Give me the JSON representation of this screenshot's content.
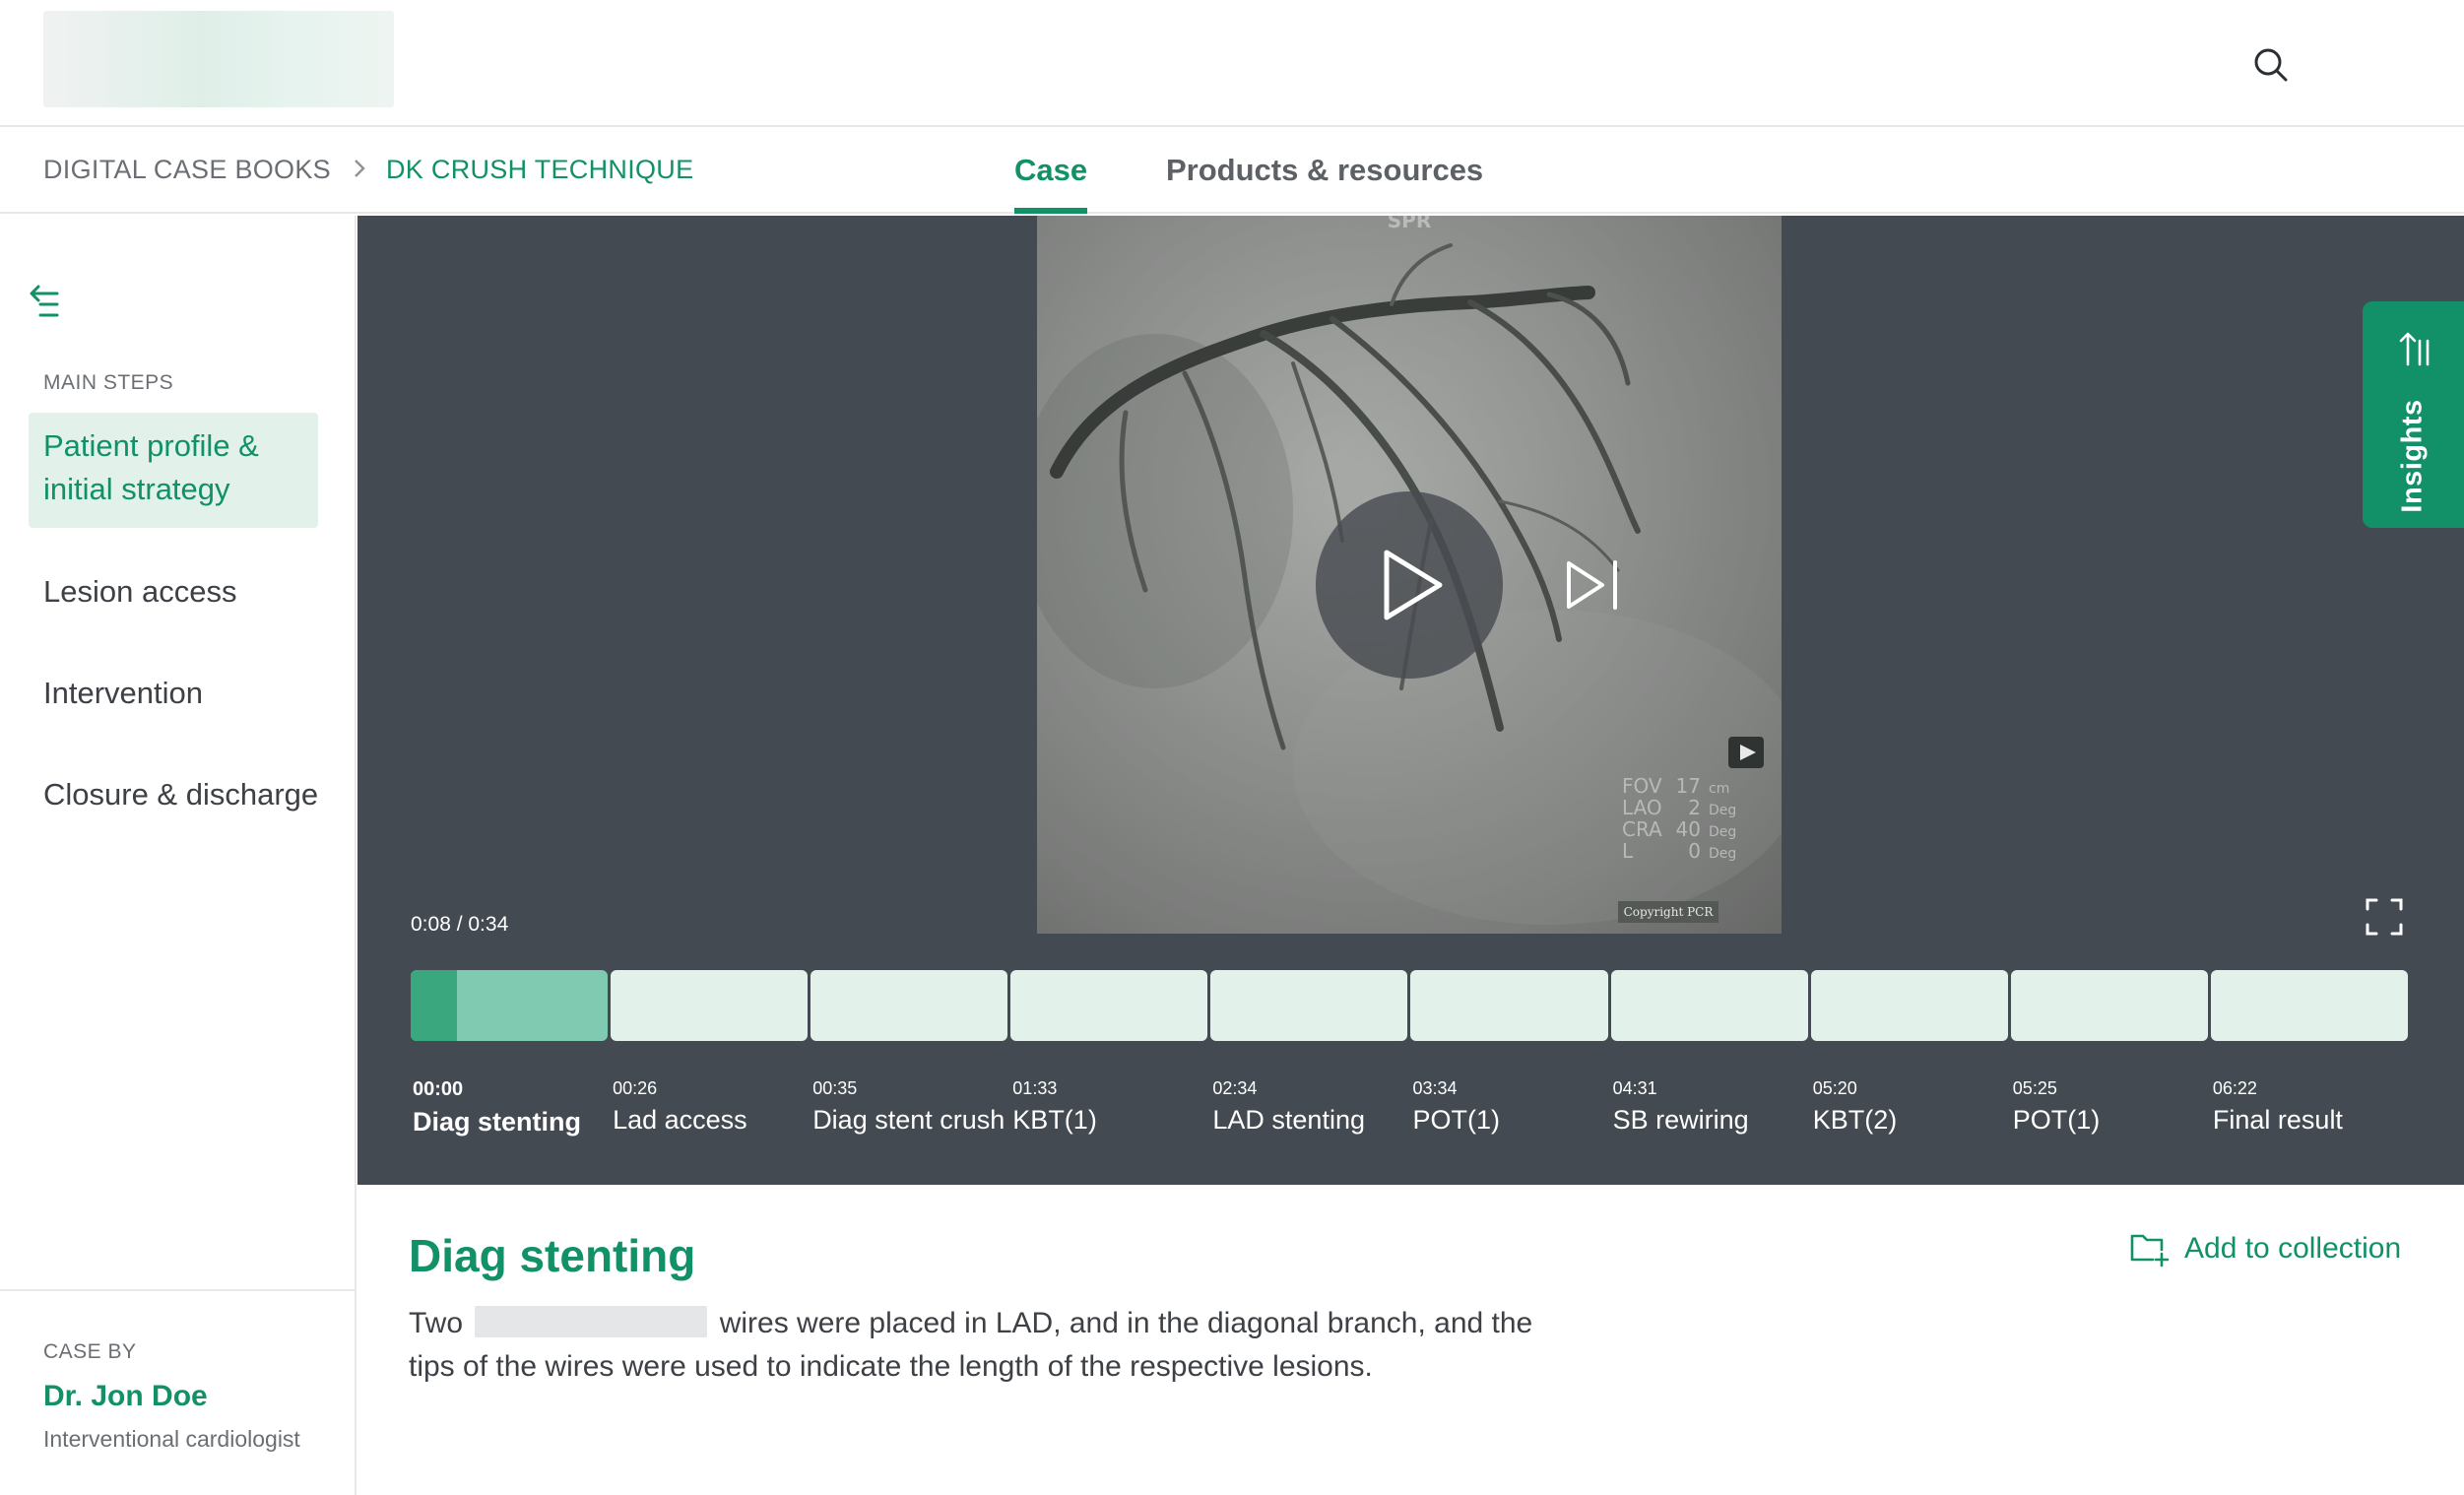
{
  "header": {
    "logo_alt": "",
    "search_icon": "search-icon"
  },
  "breadcrumb": {
    "root": "DIGITAL CASE BOOKS",
    "separator": ">",
    "current": "DK CRUSH TECHNIQUE"
  },
  "tabs": [
    {
      "label": "Case",
      "active": true
    },
    {
      "label": "Products & resources",
      "active": false
    }
  ],
  "sidebar": {
    "collapse_icon": "collapse-menu-icon",
    "heading": "MAIN STEPS",
    "steps": [
      {
        "label": "Patient profile & initial strategy",
        "active": true
      },
      {
        "label": "Lesion access",
        "active": false
      },
      {
        "label": "Intervention",
        "active": false
      },
      {
        "label": "Closure & discharge",
        "active": false
      }
    ],
    "case_by_label": "CASE BY",
    "author_name": "Dr. Jon Doe",
    "author_role": "Interventional cardiologist"
  },
  "player": {
    "time_readout": "0:08 / 0:34",
    "progress_fraction": 0.235,
    "insights_label": "Insights",
    "chapters": [
      {
        "time": "00:00",
        "title": "Diag stenting",
        "current": true
      },
      {
        "time": "00:26",
        "title": "Lad access",
        "current": false
      },
      {
        "time": "00:35",
        "title": "Diag stent crush",
        "current": false
      },
      {
        "time": "01:33",
        "title": "KBT(1)",
        "current": false
      },
      {
        "time": "02:34",
        "title": "LAD stenting",
        "current": false
      },
      {
        "time": "03:34",
        "title": "POT(1)",
        "current": false
      },
      {
        "time": "04:31",
        "title": "SB rewiring",
        "current": false
      },
      {
        "time": "05:20",
        "title": "KBT(2)",
        "current": false
      },
      {
        "time": "05:25",
        "title": "POT(1)",
        "current": false
      },
      {
        "time": "06:22",
        "title": "Final result",
        "current": false
      }
    ],
    "frame_overlay": {
      "top_label": "SPR",
      "params": [
        {
          "key": "FOV",
          "value": "17",
          "unit": "cm"
        },
        {
          "key": "LAO",
          "value": "2",
          "unit": "Deg"
        },
        {
          "key": "CRA",
          "value": "40",
          "unit": "Deg"
        },
        {
          "key": "L",
          "value": "0",
          "unit": "Deg"
        }
      ],
      "copyright": "Copyright PCR"
    }
  },
  "content": {
    "title": "Diag stenting",
    "add_to_collection": "Add to collection",
    "text_before": "Two",
    "text_after": "wires were placed in LAD, and in the diagonal branch, and the tips of the wires were used to indicate the length of the respective lesions."
  },
  "colors": {
    "brand": "#129068",
    "active_bg": "#e2f2eb",
    "player_bg": "#434a51",
    "segment_active": "#7fcab0",
    "segment_progress": "#3aa77f"
  }
}
